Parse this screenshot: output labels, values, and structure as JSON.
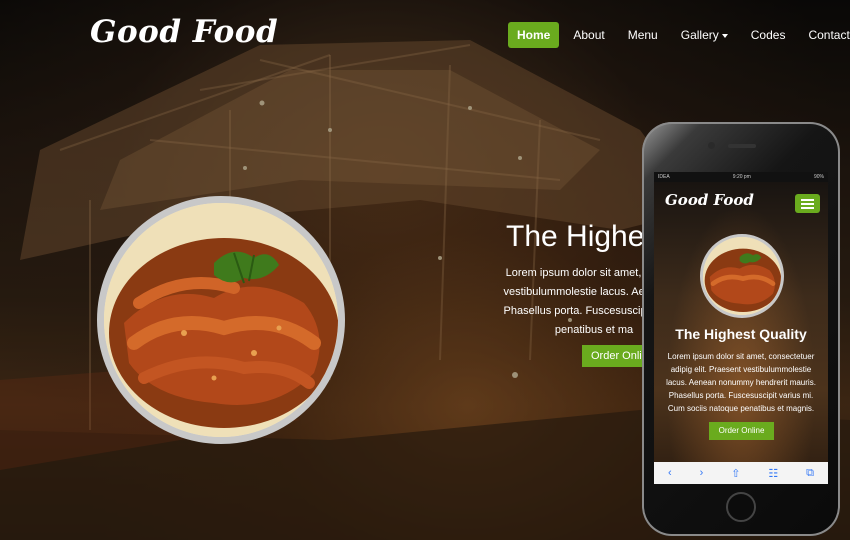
{
  "header": {
    "logo": "Good Food",
    "nav": [
      {
        "label": "Home",
        "active": true
      },
      {
        "label": "About"
      },
      {
        "label": "Menu"
      },
      {
        "label": "Gallery",
        "dropdown": true
      },
      {
        "label": "Codes"
      },
      {
        "label": "Contact"
      }
    ]
  },
  "hero": {
    "title": "The Highest",
    "body_lines": [
      "Lorem ipsum dolor sit amet, consect",
      "vestibulummolestie lacus. Aenean no",
      "Phasellus porta. Fuscesuscipit varius",
      "penatibus et ma"
    ],
    "button": "Order Online"
  },
  "mobile": {
    "status": {
      "carrier": "IDEA",
      "time": "9:20 pm",
      "battery": "90%"
    },
    "logo": "Good Food",
    "title": "The Highest Quality",
    "body_lines": [
      "Lorem ipsum dolor sit amet, consectetuer",
      "adipig elit. Praesent vestibulummolestie",
      "lacus. Aenean nonummy hendrerit mauris.",
      "Phasellus porta. Fuscesuscipit varius mi.",
      "Cum sociis natoque penatibus et magnis."
    ],
    "button": "Order Online",
    "toolbar_icons": [
      "back-icon",
      "forward-icon",
      "share-icon",
      "bookmarks-icon",
      "tabs-icon"
    ]
  },
  "colors": {
    "accent": "#6aab1e"
  }
}
